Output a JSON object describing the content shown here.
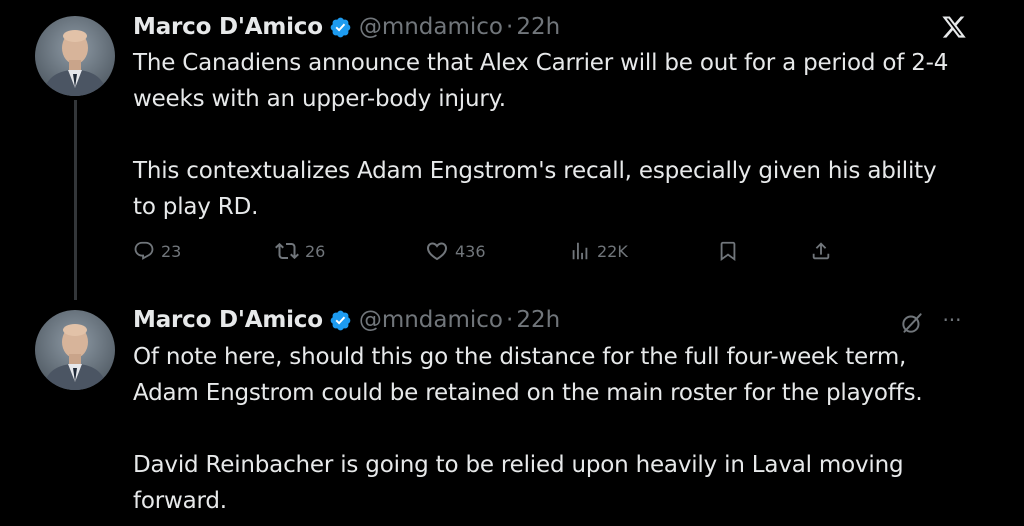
{
  "colors": {
    "background": "#000000",
    "text_primary": "#e7e9ea",
    "text_secondary": "#71767b",
    "verified_badge": "#1d9bf0",
    "thread_line": "#333639"
  },
  "tweets": [
    {
      "author": {
        "name": "Marco D'Amico",
        "handle": "@mndamico",
        "verified_icon": "verified-badge-icon",
        "avatar_icon": "profile-avatar"
      },
      "separator": "·",
      "time": "22h",
      "text": "The Canadiens announce that Alex Carrier will be out for a period of 2-4\nweeks with an upper-body injury.\n\nThis contextualizes Adam Engstrom's recall, especially given his ability\nto play RD.",
      "top_right_icon": "x-logo-icon",
      "actions": {
        "reply": {
          "icon": "reply-icon",
          "count": "23"
        },
        "repost": {
          "icon": "repost-icon",
          "count": "26"
        },
        "like": {
          "icon": "heart-icon",
          "count": "436"
        },
        "views": {
          "icon": "views-icon",
          "count": "22K"
        },
        "bookmark": {
          "icon": "bookmark-icon"
        },
        "share": {
          "icon": "share-icon"
        }
      }
    },
    {
      "author": {
        "name": "Marco D'Amico",
        "handle": "@mndamico",
        "verified_icon": "verified-badge-icon",
        "avatar_icon": "profile-avatar"
      },
      "separator": "·",
      "time": "22h",
      "text": "Of note here, should this go the distance for the full four-week term,\nAdam Engstrom could be retained on the main roster for the playoffs.\n\nDavid Reinbacher is going to be relied upon heavily in Laval moving\nforward.",
      "top_right_icons": [
        "grok-icon",
        "more-icon"
      ],
      "more_label": "···"
    }
  ]
}
